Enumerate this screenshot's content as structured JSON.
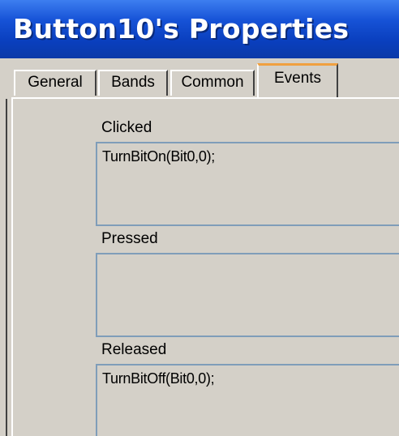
{
  "window": {
    "title": "Button10's Properties"
  },
  "tabs": [
    {
      "label": "General",
      "active": false
    },
    {
      "label": "Bands",
      "active": false
    },
    {
      "label": "Common",
      "active": false
    },
    {
      "label": "Events",
      "active": true
    }
  ],
  "events": {
    "clicked": {
      "label": "Clicked",
      "value": "TurnBitOn(Bit0,0);"
    },
    "pressed": {
      "label": "Pressed",
      "value": ""
    },
    "released": {
      "label": "Released",
      "value": "TurnBitOff(Bit0,0);"
    }
  },
  "colors": {
    "title_bar": "#0a3fbe",
    "title_text": "#ffffff",
    "dialog_face": "#d4d0c8",
    "active_tab_highlight": "#f0a040",
    "field_border": "#7f9db9"
  }
}
